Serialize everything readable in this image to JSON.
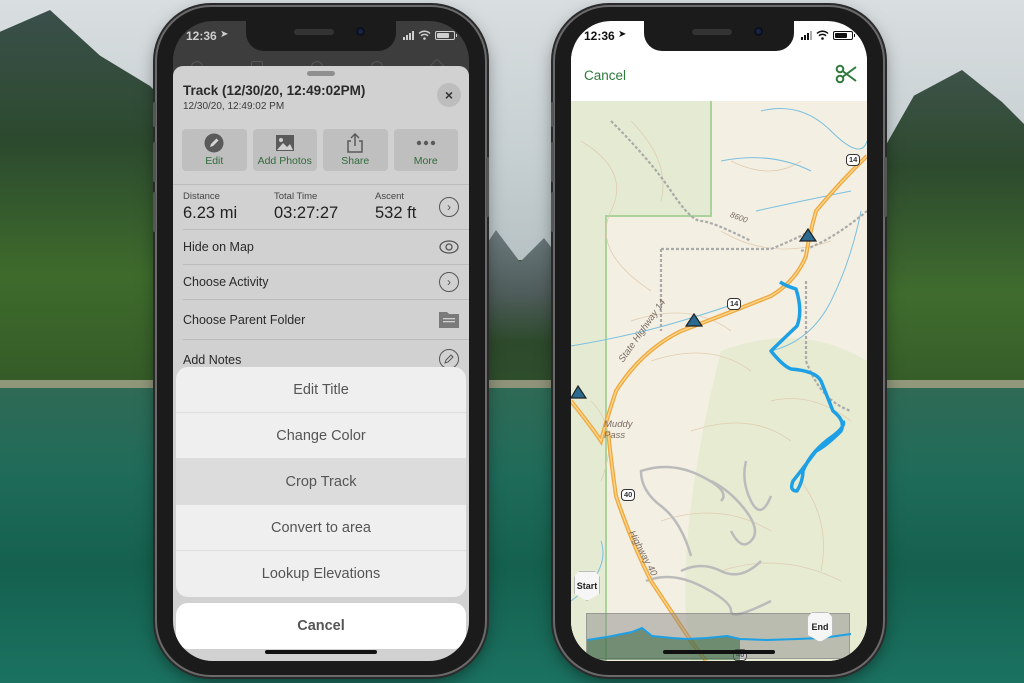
{
  "left_phone": {
    "status": {
      "time": "12:36"
    },
    "sheet": {
      "title": "Track (12/30/20, 12:49:02PM)",
      "subtitle": "12/30/20, 12:49:02 PM",
      "close_label": "×",
      "actions": [
        {
          "label": "Edit",
          "icon": "pencil-icon"
        },
        {
          "label": "Add Photos",
          "icon": "photo-icon"
        },
        {
          "label": "Share",
          "icon": "share-icon"
        },
        {
          "label": "More",
          "icon": "more-icon"
        }
      ],
      "stats": [
        {
          "label": "Distance",
          "value": "6.23 mi"
        },
        {
          "label": "Total Time",
          "value": "03:27:27"
        },
        {
          "label": "Ascent",
          "value": "532 ft"
        }
      ],
      "rows": [
        {
          "label": "Hide on Map",
          "icon": "eye-icon"
        },
        {
          "label": "Choose Activity",
          "icon": "chevron-right-icon"
        },
        {
          "label": "Choose Parent Folder",
          "icon": "folder-icon"
        },
        {
          "label": "Add Notes",
          "icon": "pencil-icon"
        }
      ]
    },
    "action_sheet": {
      "items": [
        "Edit Title",
        "Change Color",
        "Crop Track",
        "Convert to area",
        "Lookup Elevations"
      ],
      "highlighted": "Crop Track",
      "cancel_label": "Cancel"
    }
  },
  "right_phone": {
    "status": {
      "time": "12:36"
    },
    "nav": {
      "cancel_label": "Cancel",
      "action_icon": "scissors-icon"
    },
    "map": {
      "labels": {
        "state_highway": "State Highway 14",
        "highway_40": "Highway 40",
        "muddy_pass": "Muddy\nPass",
        "contour": "8600"
      },
      "shields": [
        "14",
        "14",
        "40",
        "40"
      ],
      "markers": {
        "start": "Start",
        "end": "End"
      },
      "track_color": "#1ea0e6"
    },
    "elevation_profile": {
      "crop_start_fraction": 0.0,
      "crop_end_fraction": 0.88,
      "shaded_fraction": 0.58
    }
  },
  "colors": {
    "accent_green": "#2f7a3c",
    "track_blue": "#1ea0e6",
    "highway_orange": "#f0a63a"
  }
}
